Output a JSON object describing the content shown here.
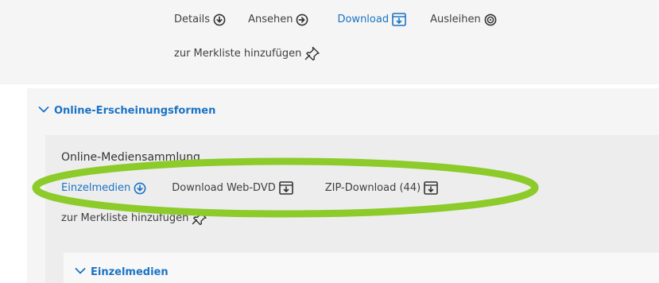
{
  "top_actions": {
    "details": "Details",
    "ansehen": "Ansehen",
    "download": "Download",
    "ausleihen": "Ausleihen",
    "merkliste": "zur Merkliste hinzufügen"
  },
  "section": {
    "title": "Online-Erscheinungsformen",
    "item_title": "Online-Mediensammlung",
    "actions": {
      "einzelmedien": "Einzelmedien",
      "web_dvd": "Download Web-DVD",
      "zip": "ZIP-Download (44)",
      "merkliste": "zur Merkliste hinzufügen"
    },
    "sub_section_title": "Einzelmedien"
  },
  "colors": {
    "link": "#1a73c4",
    "text": "#404040",
    "highlight": "#8ccb2a",
    "card_bg": "#f5f5f5"
  },
  "icons": {
    "details": "arrow-down-circle-icon",
    "ansehen": "arrow-right-circle-icon",
    "download": "download-box-icon",
    "ausleihen": "disc-icon",
    "merkliste": "pin-icon",
    "section_toggle": "chevron-down-icon"
  }
}
